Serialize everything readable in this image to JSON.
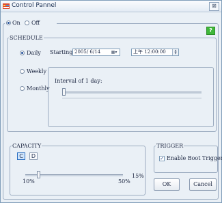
{
  "window": {
    "title": "Control Pannel",
    "close_glyph": "⊠"
  },
  "mode": {
    "on_label": "On",
    "off_label": "Off",
    "selected": "On"
  },
  "help_label": "?",
  "schedule": {
    "legend": "SCHEDULE",
    "options": [
      "Daily",
      "Weekly",
      "Monthly"
    ],
    "selected": "Daily",
    "starting_label": "Starting :",
    "date_value": "2005/ 6/14",
    "time_value": "上午 12:00:00",
    "interval_text": "Interval of  1    day:",
    "interval_value": 1
  },
  "capacity": {
    "legend": "CAPACITY",
    "drives": [
      "C",
      "D"
    ],
    "selected_drive": "C",
    "min_label": "10%",
    "max_label": "50%",
    "current_label": "15%",
    "current_value": 15
  },
  "trigger": {
    "legend": "TRIGGER",
    "checkbox_label": "Enable Boot Trigger",
    "checked": true
  },
  "buttons": {
    "ok": "OK",
    "cancel": "Cancel"
  },
  "icons": {
    "app": "control-panel-app-icon",
    "calendar": "calendar-icon",
    "dropdown": "chevron-down-icon",
    "spin": "spin-updown-icon",
    "check": "checkmark-icon"
  }
}
